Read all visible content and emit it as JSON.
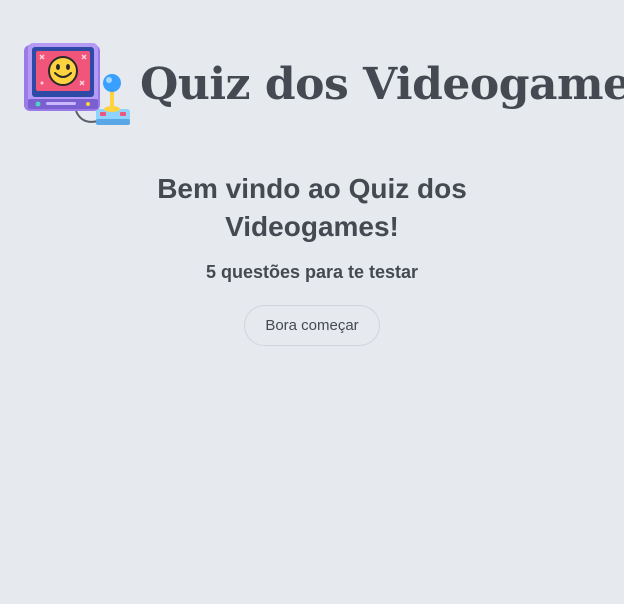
{
  "header": {
    "title": "Quiz dos Videogames",
    "logo_icon": "retro-computer-joystick-icon"
  },
  "main": {
    "welcome_title": "Bem vindo ao Quiz dos Videogames!",
    "subtitle": "5 questões para te testar",
    "start_button_label": "Bora começar"
  },
  "colors": {
    "background": "#e6e9ee",
    "text": "#454a52",
    "button_border": "#d2d6dc"
  }
}
